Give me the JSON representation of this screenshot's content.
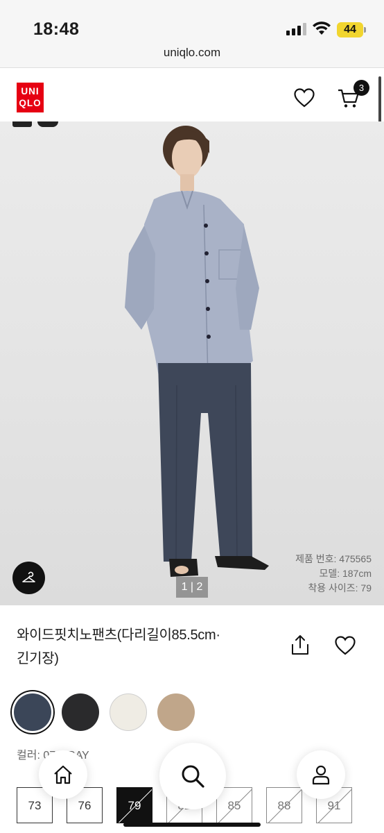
{
  "status_bar": {
    "time": "18:48",
    "battery": "44"
  },
  "browser": {
    "url": "uniqlo.com"
  },
  "header": {
    "logo_top": "UNI",
    "logo_bottom": "QLO",
    "cart_count": "3",
    "brand_color": "#e60012"
  },
  "hero": {
    "pager": "1 | 2",
    "meta": {
      "product_number": "제품 번호: 475565",
      "model": "모델: 187cm",
      "wearing_size": "착용 사이즈: 79"
    }
  },
  "product": {
    "title_line1": "와이드핏치노팬츠(다리길이85.5cm·",
    "title_line2": "긴기장)"
  },
  "colors": {
    "label": "컬러: 07 GRAY",
    "swatches": [
      {
        "name": "navy-gray",
        "hex": "#3b4658",
        "selected": true
      },
      {
        "name": "black",
        "hex": "#2a2a2c",
        "selected": false
      },
      {
        "name": "off-white",
        "hex": "#efece4",
        "selected": false
      },
      {
        "name": "beige",
        "hex": "#c0a68a",
        "selected": false
      }
    ]
  },
  "sizes": [
    {
      "label": "73",
      "state": "available"
    },
    {
      "label": "76",
      "state": "available"
    },
    {
      "label": "79",
      "state": "selected"
    },
    {
      "label": "82",
      "state": "soldout"
    },
    {
      "label": "85",
      "state": "soldout"
    },
    {
      "label": "88",
      "state": "soldout"
    },
    {
      "label": "91",
      "state": "soldout"
    }
  ],
  "bottom_nav": [
    "home-icon",
    "search-icon",
    "user-icon"
  ]
}
